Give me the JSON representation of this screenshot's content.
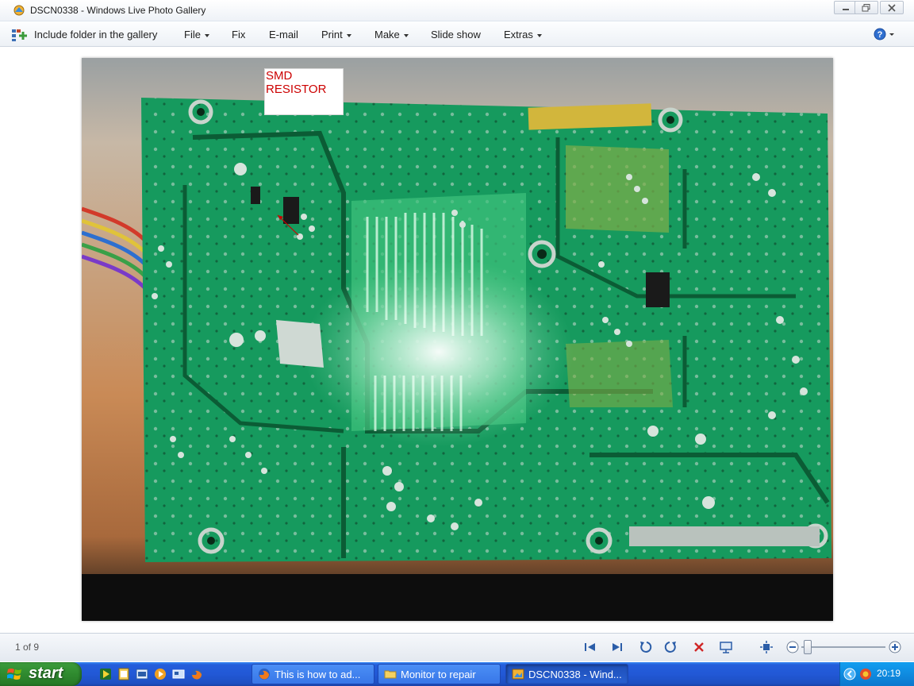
{
  "window": {
    "title": "DSCN0338 - Windows Live Photo Gallery"
  },
  "menu": {
    "include_folder": "Include folder in the gallery",
    "file": "File",
    "fix": "Fix",
    "email": "E-mail",
    "print": "Print",
    "make": "Make",
    "slideshow": "Slide show",
    "extras": "Extras"
  },
  "photo": {
    "annotation_line1": "SMD",
    "annotation_line2": "RESISTOR",
    "annotation_color": "#cc0000"
  },
  "controls": {
    "counter": "1 of 9",
    "zoom_level": 0.02
  },
  "taskbar": {
    "start_label": "start",
    "tasks": [
      {
        "label": "This is how to ad...",
        "icon": "firefox-icon"
      },
      {
        "label": "Monitor to repair",
        "icon": "folder-icon"
      },
      {
        "label": "DSCN0338 - Wind...",
        "icon": "photo-gallery-icon"
      }
    ],
    "clock": "20:19"
  },
  "colors": {
    "pcb_green": "#1ea86a",
    "taskbar_blue": "#245edb",
    "start_green": "#2f8a2f"
  }
}
